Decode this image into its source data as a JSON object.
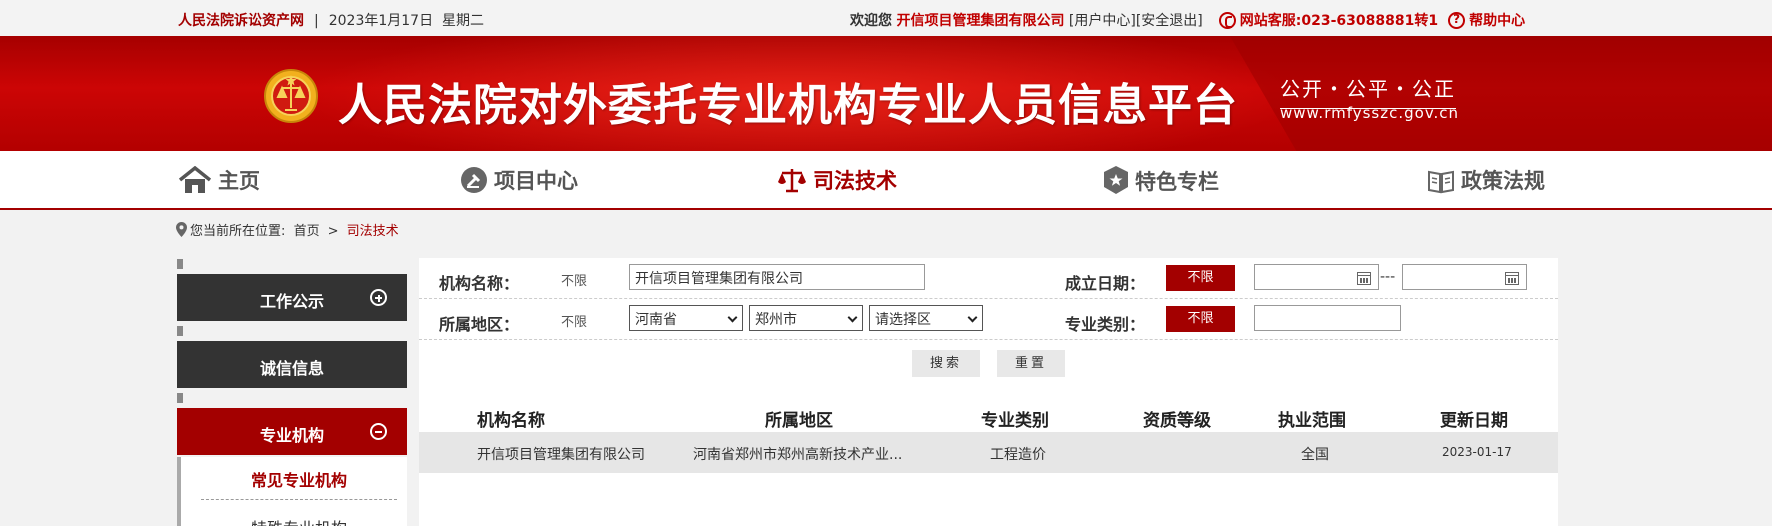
{
  "topbar": {
    "site_name": "人民法院诉讼资产网",
    "separator": "|",
    "date": "2023年1月17日",
    "weekday": "星期二",
    "welcome": "欢迎您",
    "company": "开信项目管理集团有限公司",
    "user_center": "[用户中心]",
    "logout": "[安全退出]",
    "hotline": "网站客服:023-63088881转1",
    "help": "帮助中心"
  },
  "banner": {
    "title": "人民法院对外委托专业机构专业人员信息平台",
    "motto": "公开・公平・公正",
    "url": "www.rmfysszc.gov.cn"
  },
  "nav": {
    "items": [
      {
        "label": "主页",
        "icon": "home-icon"
      },
      {
        "label": "项目中心",
        "icon": "gavel-icon"
      },
      {
        "label": "司法技术",
        "icon": "scales-icon",
        "active": true
      },
      {
        "label": "特色专栏",
        "icon": "star-shield-icon"
      },
      {
        "label": "政策法规",
        "icon": "book-icon"
      }
    ]
  },
  "breadcrumb": {
    "prefix": "您当前所在位置:",
    "home": "首页",
    "gt": ">",
    "current": "司法技术"
  },
  "sidebar": {
    "blocks": [
      {
        "label": "工作公示",
        "state": "collapsed"
      },
      {
        "label": "诚信信息"
      },
      {
        "label": "专业机构",
        "state": "expanded"
      }
    ],
    "sub_items": [
      "常见专业机构",
      "特殊专业机构"
    ]
  },
  "filters": {
    "org_name_label": "机构名称：",
    "org_name_nolimit": "不限",
    "org_name_value": "开信项目管理集团有限公司",
    "found_date_label": "成立日期：",
    "found_date_nolimit": "不限",
    "found_date_from": "",
    "found_date_to": "",
    "date_dash": "---",
    "region_label": "所属地区：",
    "region_nolimit": "不限",
    "province": "河南省",
    "city": "郑州市",
    "district": "请选择区",
    "category_label": "专业类别：",
    "category_nolimit": "不限",
    "category_value": "",
    "search_button": "搜索",
    "reset_button": "重置"
  },
  "table": {
    "columns": [
      "机构名称",
      "所属地区",
      "专业类别",
      "资质等级",
      "执业范围",
      "更新日期"
    ],
    "rows": [
      {
        "name": "开信项目管理集团有限公司",
        "region": "河南省郑州市郑州高新技术产业...",
        "category": "工程造价",
        "qualification": "",
        "scope": "全国",
        "updated": "2023-01-17"
      }
    ]
  },
  "colors": {
    "brand_red": "#a30000",
    "dark_block": "#333333"
  }
}
